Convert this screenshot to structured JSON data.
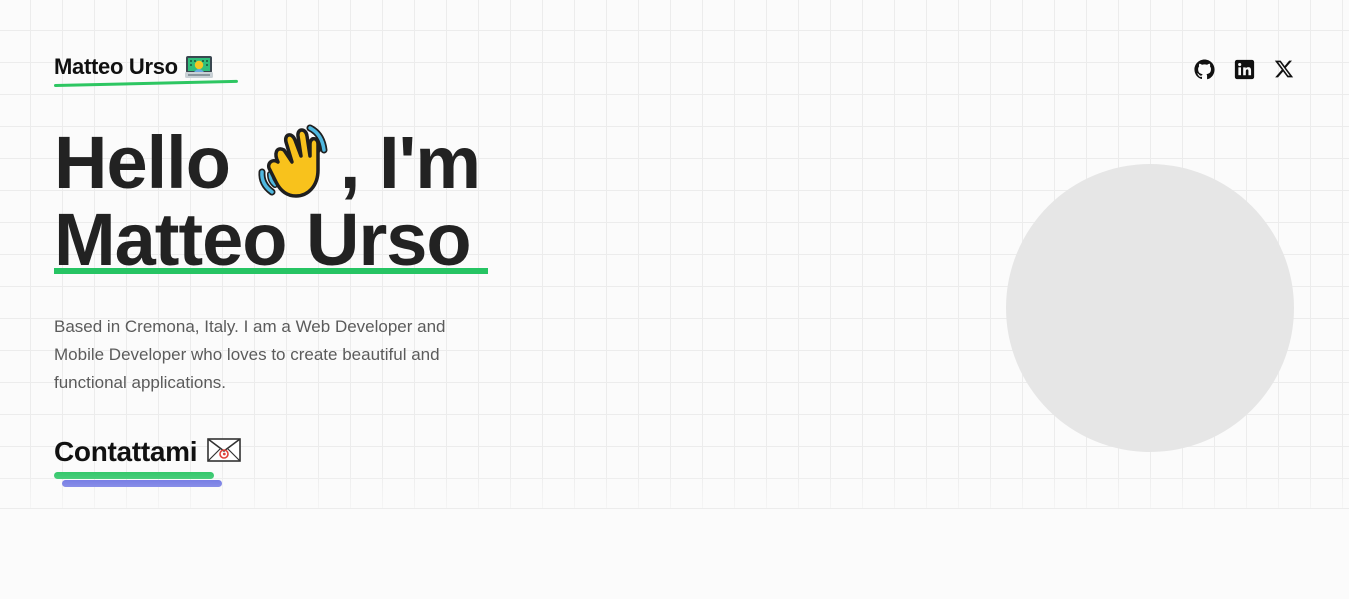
{
  "brand": {
    "name": "Matteo Urso",
    "icon": "technologist-icon",
    "underline_color": "#2ec662"
  },
  "socials": [
    {
      "name": "github-icon"
    },
    {
      "name": "linkedin-icon"
    },
    {
      "name": "x-twitter-icon"
    }
  ],
  "hero": {
    "greeting": "Hello",
    "wave_icon": "waving-hand-icon",
    "greeting_suffix": ", I'm",
    "name": "Matteo Urso",
    "name_underline_color": "#26c463",
    "bio": "Based in Cremona, Italy. I am a Web Developer and Mobile Developer who loves to create beautiful and functional applications."
  },
  "cta": {
    "label": "Contattami",
    "icon": "envelope-icon",
    "underline_colors": [
      "#27c462",
      "#5b63e0"
    ]
  },
  "avatar": {
    "state": "placeholder",
    "color": "#e6e6e6"
  }
}
